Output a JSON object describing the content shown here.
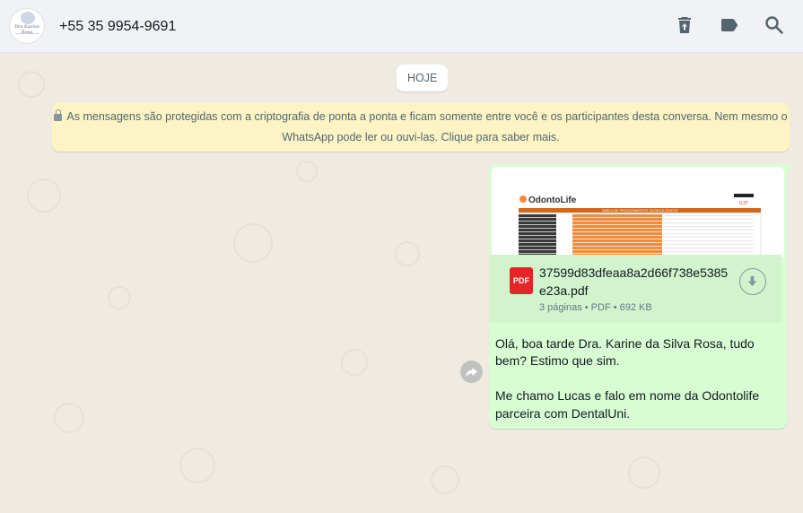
{
  "header": {
    "contact_name": "+55 35 9954-9691",
    "avatar_text": "Dra Karine Rosa",
    "icons": [
      "delete-icon",
      "label-icon",
      "search-icon"
    ]
  },
  "chat": {
    "date_chip": "HOJE",
    "encryption_notice": "As mensagens são protegidas com a criptografia de ponta a ponta e ficam somente entre você e os participantes desta conversa. Nem mesmo o WhatsApp pode ler ou ouvi-las. Clique para saber mais.",
    "document": {
      "badge": "PDF",
      "file_name": "37599d83dfeaa8a2d66f738e5385e23a.pdf",
      "meta": "3 páginas • PDF • 692 KB",
      "preview_brand": "OdontoLife",
      "preview_table_title": "TABELA DE PROCEDIMENTOS ODONTOLÓGICOS",
      "preview_price": "0,37"
    },
    "message_text": "Olá, boa tarde Dra. Karine da Silva Rosa, tudo bem? Estimo que sim.\n\nMe chamo Lucas e falo em nome da Odontolife parceira com DentalUni."
  },
  "colors": {
    "chat_background": "#efeae2",
    "outgoing_bubble": "#d9fdd3",
    "system_message": "#fdf4c5",
    "pdf_badge": "#e5252a",
    "preview_orange": "#f28c3c"
  }
}
